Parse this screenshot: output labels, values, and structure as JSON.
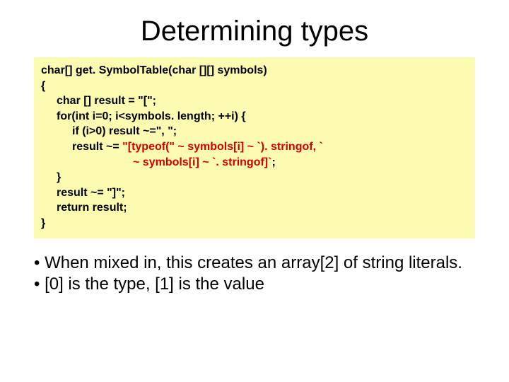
{
  "title": "Determining types",
  "code": {
    "l0": "char[] get. SymbolTable(char [][] symbols)",
    "l1": "{",
    "l2": "char [] result = \"[\";",
    "l3": "for(int i=0; i<symbols. length; ++i) {",
    "l4": "if (i>0) result ~=\", \";",
    "l5a": "result ~= ",
    "l5b": "\"[typeof(\" ~ symbols[i] ~ `). stringof, `",
    "l6a": "~ symbols[i] ~ `. stringof]`",
    "l6b": ";",
    "l7": "}",
    "l8": "result ~= \"]\";",
    "l9": "return result;",
    "l10": "}"
  },
  "bullets": {
    "b1": "• When mixed in, this creates an array[2] of string literals.",
    "b2": "• [0] is the type, [1] is the value"
  }
}
